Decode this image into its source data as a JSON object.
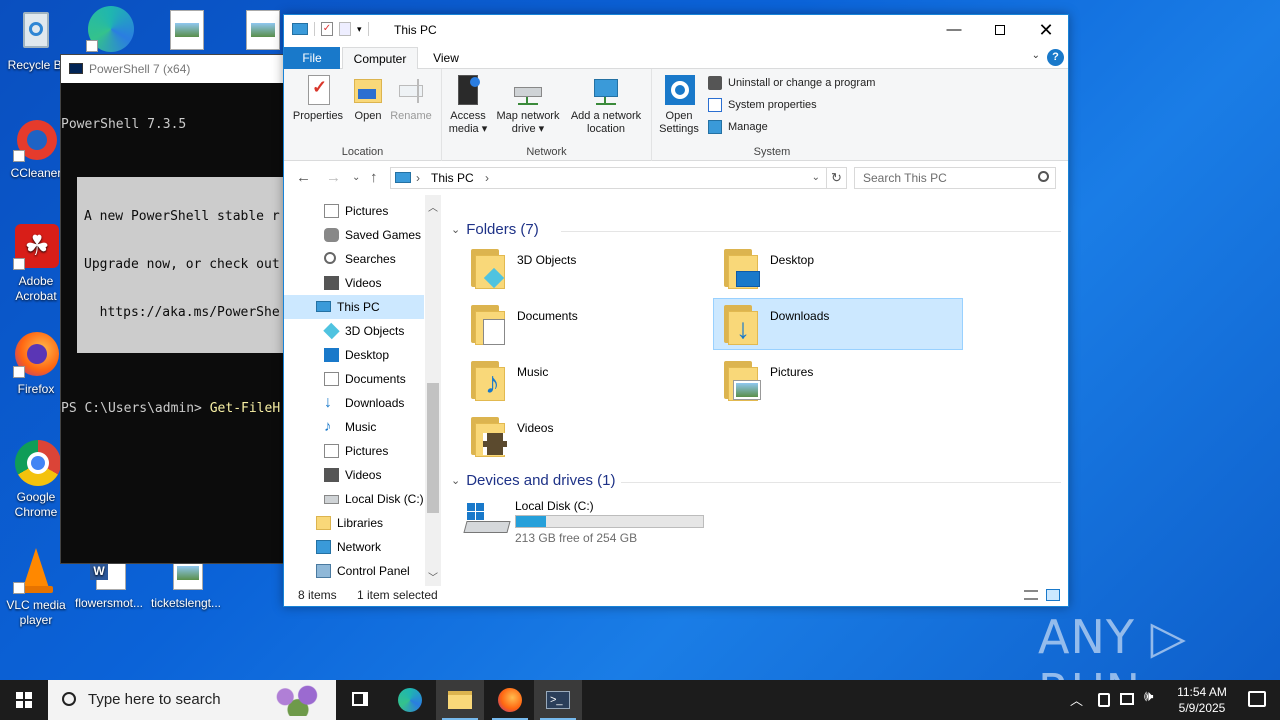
{
  "desktop": {
    "icons": [
      {
        "label": "Recycle Bin",
        "label_shown": "Recycle Bi"
      },
      {
        "label": "CCleaner",
        "label_shown": "CCleaner"
      },
      {
        "label": "Adobe Acrobat",
        "label_line1": "Adobe",
        "label_line2": "Acrobat"
      },
      {
        "label": "Firefox",
        "label_shown": "Firefox"
      },
      {
        "label": "Google Chrome",
        "label_line1": "Google",
        "label_line2": "Chrome"
      },
      {
        "label": "VLC media player",
        "label_line1": "VLC media",
        "label_line2": "player"
      },
      {
        "label": "flowersmot...",
        "label_shown": "flowersmot..."
      },
      {
        "label": "ticketslengt...",
        "label_shown": "ticketslengt..."
      }
    ]
  },
  "powershell": {
    "title": "PowerShell 7 (x64)",
    "version_line": "PowerShell 7.3.5",
    "warn1": "A new PowerShell stable r",
    "warn2": "Upgrade now, or check out",
    "warn3": "  https://aka.ms/PowerShe",
    "prompt": "PS C:\\Users\\admin> ",
    "command": "Get-FileH"
  },
  "explorer": {
    "title": "This PC",
    "tabs": {
      "file": "File",
      "computer": "Computer",
      "view": "View"
    },
    "ribbon": {
      "location": {
        "label": "Location",
        "properties": "Properties",
        "open": "Open",
        "rename": "Rename"
      },
      "network": {
        "label": "Network",
        "access_media_1": "Access",
        "access_media_2": "media ▾",
        "map_drive_1": "Map network",
        "map_drive_2": "drive ▾",
        "add_location_1": "Add a network",
        "add_location_2": "location"
      },
      "system": {
        "label": "System",
        "open_settings_1": "Open",
        "open_settings_2": "Settings",
        "uninstall": "Uninstall or change a program",
        "sys_props": "System properties",
        "manage": "Manage"
      }
    },
    "address": {
      "path": "This PC",
      "sep": "›",
      "search_placeholder": "Search This PC"
    },
    "nav": [
      {
        "label": "Pictures"
      },
      {
        "label": "Saved Games"
      },
      {
        "label": "Searches"
      },
      {
        "label": "Videos"
      },
      {
        "label": "This PC"
      },
      {
        "label": "3D Objects"
      },
      {
        "label": "Desktop"
      },
      {
        "label": "Documents"
      },
      {
        "label": "Downloads"
      },
      {
        "label": "Music"
      },
      {
        "label": "Pictures"
      },
      {
        "label": "Videos"
      },
      {
        "label": "Local Disk (C:)"
      },
      {
        "label": "Libraries"
      },
      {
        "label": "Network"
      },
      {
        "label": "Control Panel"
      }
    ],
    "folders_header": "Folders (7)",
    "folders": [
      {
        "name": "3D Objects"
      },
      {
        "name": "Desktop"
      },
      {
        "name": "Documents"
      },
      {
        "name": "Downloads"
      },
      {
        "name": "Music"
      },
      {
        "name": "Pictures"
      },
      {
        "name": "Videos"
      }
    ],
    "drives_header": "Devices and drives (1)",
    "drive": {
      "name": "Local Disk (C:)",
      "free_text": "213 GB free of 254 GB",
      "used_fraction": 0.161
    },
    "status": {
      "items": "8 items",
      "selected": "1 item selected"
    }
  },
  "watermark": "ANY ▷ RUN",
  "taskbar": {
    "search_placeholder": "Type here to search",
    "time": "11:54 AM",
    "date": "5/9/2025"
  }
}
